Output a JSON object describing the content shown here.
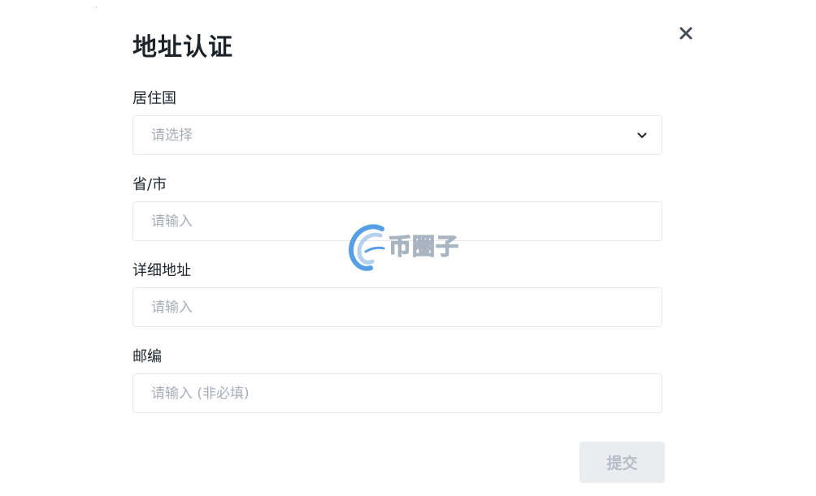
{
  "dialog": {
    "title": "地址认证"
  },
  "form": {
    "country": {
      "label": "居住国",
      "placeholder": "请选择"
    },
    "province": {
      "label": "省/市",
      "placeholder": "请输入"
    },
    "address": {
      "label": "详细地址",
      "placeholder": "请输入"
    },
    "postcode": {
      "label": "邮编",
      "placeholder": "请输入 (非必填)"
    },
    "submit_label": "提交"
  },
  "watermark": {
    "text": "币圈子"
  },
  "colors": {
    "text_primary": "#1e2329",
    "placeholder": "#a9aeb6",
    "border": "#e6e8eb",
    "button_disabled_bg": "#eaecef",
    "button_disabled_text": "#b7bdc6"
  },
  "icons": {
    "close": "close-icon",
    "select": "chevron-down-icon",
    "watermark_logo": "watermark-logo-icon"
  }
}
